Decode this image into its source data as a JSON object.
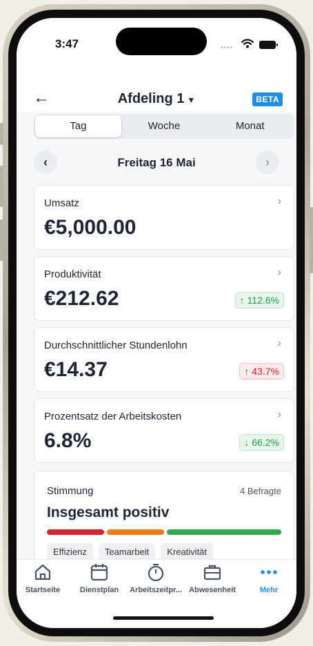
{
  "status": {
    "time": "3:47"
  },
  "header": {
    "title": "Afdeling 1",
    "beta": "BETA"
  },
  "segments": [
    {
      "label": "Tag",
      "active": true
    },
    {
      "label": "Woche",
      "active": false
    },
    {
      "label": "Monat",
      "active": false
    }
  ],
  "date": "Freitag 16 Mai",
  "cards": [
    {
      "label": "Umsatz",
      "value": "€5,000.00",
      "badge": ""
    },
    {
      "label": "Produktivität",
      "value": "€212.62",
      "badge": "↑ 112.6%",
      "badge_type": "up"
    },
    {
      "label": "Durchschnittlicher Stundenlohn",
      "value": "€14.37",
      "badge": "↑ 43.7%",
      "badge_type": "bad"
    },
    {
      "label": "Prozentsatz der Arbeitskosten",
      "value": "6.8%",
      "badge": "↓ 66.2%",
      "badge_type": "up"
    }
  ],
  "mood": {
    "label": "Stimmung",
    "count": "4 Befragte",
    "headline": "Insgesamt positiv",
    "segments": [
      {
        "share": 0.25,
        "color": "#d2232e"
      },
      {
        "share": 0.25,
        "color": "#ef7d17"
      },
      {
        "share": 0.5,
        "color": "#2fa84f"
      }
    ],
    "tags": [
      "Effizienz",
      "Teamarbeit",
      "Kreativität"
    ]
  },
  "tabs": [
    {
      "label": "Startseite",
      "icon": "home-icon"
    },
    {
      "label": "Dienstplan",
      "icon": "calendar-icon"
    },
    {
      "label": "Arbeitszeitpr...",
      "icon": "stopwatch-icon"
    },
    {
      "label": "Abwesenheit",
      "icon": "briefcase-icon"
    },
    {
      "label": "Mehr",
      "icon": "more-icon",
      "active": true
    }
  ],
  "colors": {
    "accent": "#1d8fe0",
    "text": "#1d2433"
  }
}
